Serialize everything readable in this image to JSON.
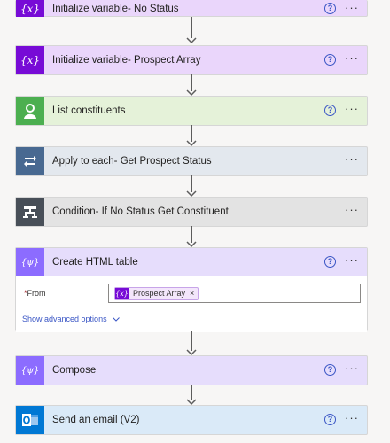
{
  "steps": [
    {
      "title": "Initialize variable- No Status",
      "type": "variable"
    },
    {
      "title": "Initialize variable- Prospect Array",
      "type": "variable"
    },
    {
      "title": "List constituents",
      "type": "connector"
    },
    {
      "title": "Apply to each- Get Prospect Status",
      "type": "loop"
    },
    {
      "title": "Condition- If No Status Get Constituent",
      "type": "condition"
    },
    {
      "title": "Create HTML table",
      "type": "data-operation"
    },
    {
      "title": "Compose",
      "type": "data-operation"
    },
    {
      "title": "Send an email (V2)",
      "type": "outlook"
    }
  ],
  "common": {
    "help_glyph": "?",
    "more_glyph": "···",
    "variable_glyph": "{x}"
  },
  "html_table": {
    "from_label": "From",
    "required_mark": "*",
    "from_token": "Prospect Array",
    "token_remove": "×",
    "show_advanced": "Show advanced options"
  },
  "colors": {
    "variable": "#770bd6",
    "variable_bg": "#ead6fb",
    "connector": "#4caf50",
    "connector_bg": "#e5f2d9",
    "loop": "#486991",
    "loop_bg": "#e3e8ee",
    "condition": "#484f58",
    "condition_bg": "#e3e3e3",
    "data_op": "#8c6cff",
    "data_op_bg": "#e6ddfc",
    "outlook": "#0078d4",
    "outlook_bg": "#daeaf8",
    "link": "#3a56c5"
  }
}
